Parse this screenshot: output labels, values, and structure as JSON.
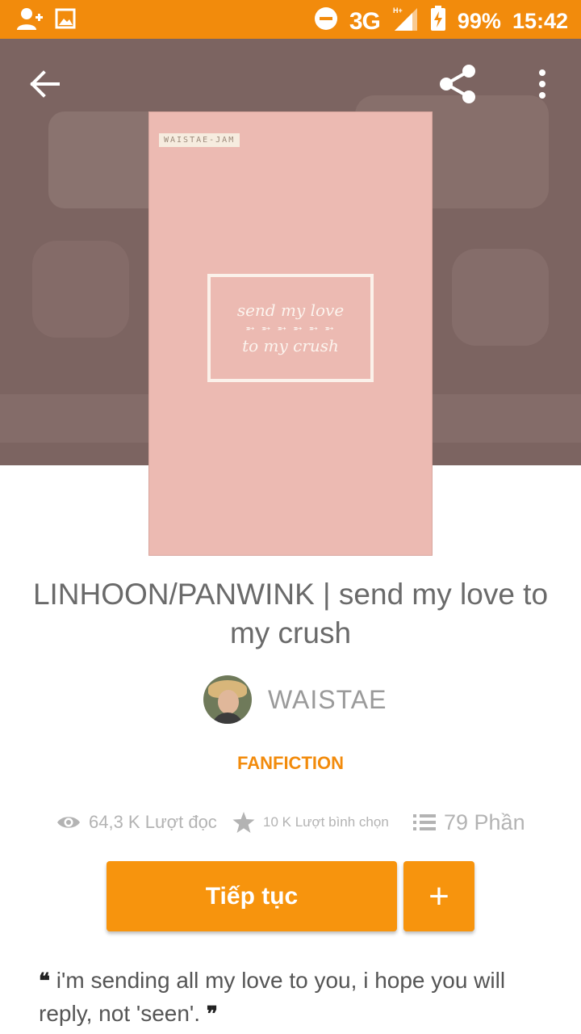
{
  "status_bar": {
    "network": "3G",
    "network_sup": "H+",
    "battery": "99%",
    "time": "15:42"
  },
  "cover": {
    "tag": "WAISTAE-JAM",
    "line1": "send my love",
    "arrows": "➵ ➵ ➵ ➵ ➵ ➵",
    "line2": "to my crush"
  },
  "story": {
    "title": "LINHOON/PANWINK | send my love to my crush",
    "author": "WAISTAE",
    "category": "FANFICTION"
  },
  "stats": {
    "reads": "64,3 K Lượt đọc",
    "votes": "10 K Lượt bình chọn",
    "parts": "79 Phần"
  },
  "actions": {
    "continue_label": "Tiếp tục",
    "add_label": "+"
  },
  "description": {
    "text": "i'm sending all my love to you, i hope you will reply, not 'seen'."
  },
  "colors": {
    "accent": "#f28b0c",
    "button": "#f7940d",
    "header_bg": "#7c6461",
    "cover_bg": "#ecbab2"
  }
}
